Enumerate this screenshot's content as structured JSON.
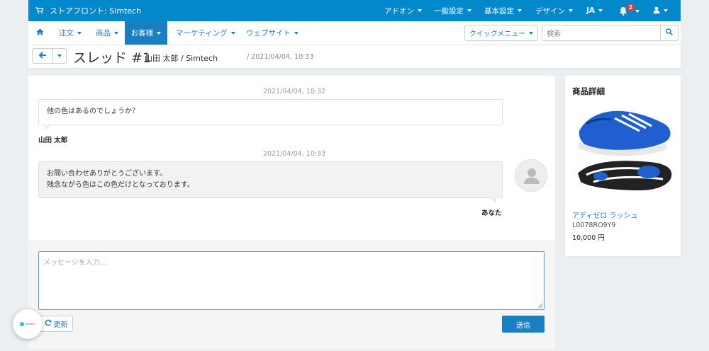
{
  "colors": {
    "topbar": "#0388cc",
    "accent": "#1a7fc1",
    "badge": "#d9423a"
  },
  "topbar": {
    "store_label": "ストアフロント: Simtech",
    "menus": [
      "アドオン",
      "一般設定",
      "基本設定",
      "デザイン",
      "JA"
    ],
    "notification_count": "2"
  },
  "nav": {
    "items": [
      "注文",
      "商品",
      "お客様",
      "マーケティング",
      "ウェブサイト"
    ],
    "active": "お客様",
    "quick_menu": "クイックメニュー",
    "search_placeholder": "検索"
  },
  "title": {
    "heading": "スレッド #1",
    "subtitle": "山田 太郎 / Simtech",
    "date": "/ 2021/04/04, 10:33"
  },
  "messages": [
    {
      "time": "2021/04/04, 10:32",
      "lines": [
        "他の色はあるのでしょうか？"
      ],
      "author": "山田 太郎",
      "side": "customer"
    },
    {
      "time": "2021/04/04, 10:33",
      "lines": [
        "お問い合わせありがとうございます。",
        "残念ながら色はこの色だけとなっております。"
      ],
      "author": "あなた",
      "side": "admin"
    }
  ],
  "composer": {
    "placeholder": "メッセージを入力...",
    "refresh_label": "更新",
    "send_label": "送信"
  },
  "product": {
    "panel_title": "商品詳細",
    "name": "アディゼロ ラッシュ",
    "code": "L0078RO9Y9",
    "price": "10,000 円"
  },
  "widget": {
    "label": "SIMTECH"
  },
  "icons": [
    "cart-icon",
    "bell-icon",
    "user-icon",
    "home-icon",
    "search-icon",
    "arrow-left-icon",
    "refresh-icon",
    "avatar-icon"
  ]
}
